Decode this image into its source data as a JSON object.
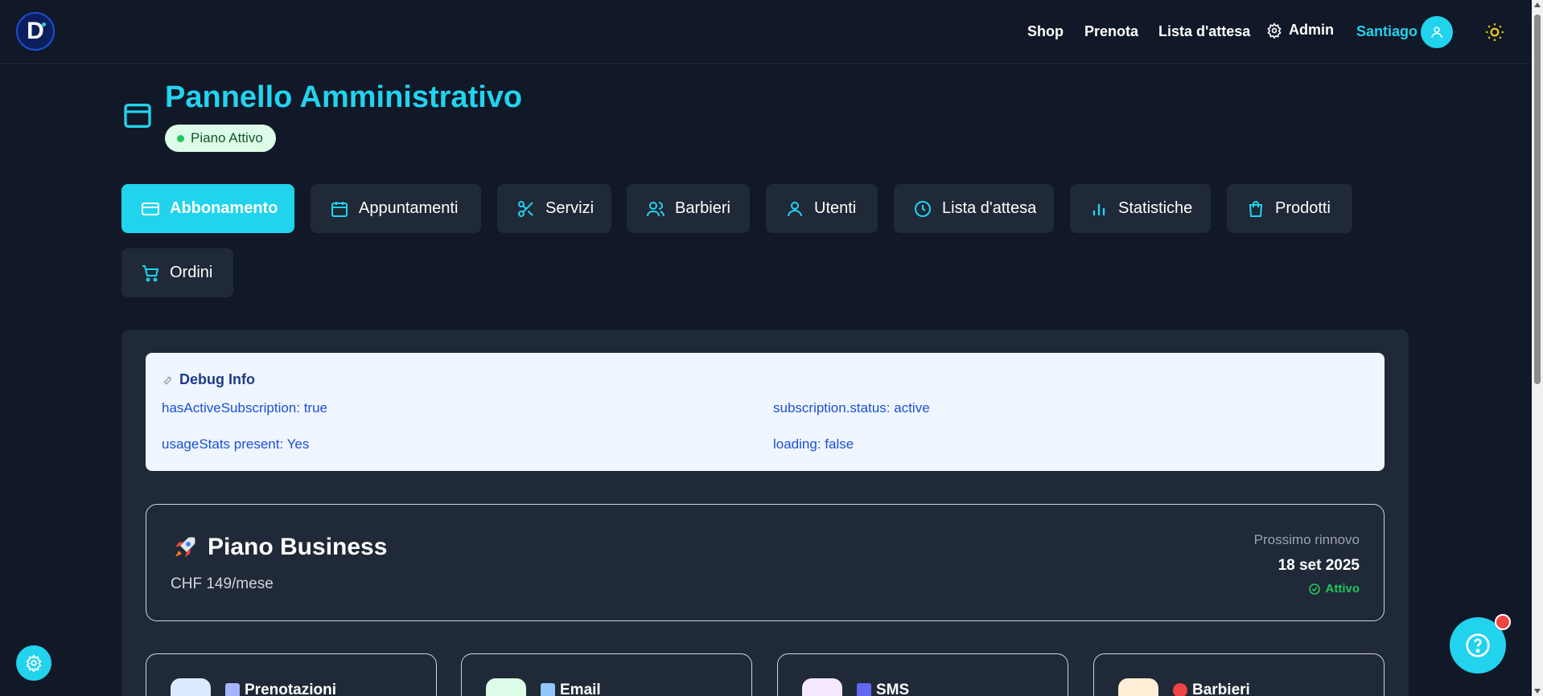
{
  "header": {
    "logo_letter": "D",
    "nav": [
      {
        "label": "Shop"
      },
      {
        "label": "Prenota"
      },
      {
        "label": "Lista d'attesa"
      },
      {
        "label": "Admin"
      }
    ],
    "user_name": "Santiago"
  },
  "page": {
    "title": "Pannello Amministrativo",
    "badge": "Piano Attivo"
  },
  "tabs": [
    {
      "label": "Abbonamento",
      "icon": "credit-card-icon",
      "active": true
    },
    {
      "label": "Appuntamenti",
      "icon": "calendar-icon"
    },
    {
      "label": "Servizi",
      "icon": "scissors-icon"
    },
    {
      "label": "Barbieri",
      "icon": "users-icon"
    },
    {
      "label": "Utenti",
      "icon": "user-icon"
    },
    {
      "label": "Lista d'attesa",
      "icon": "clock-icon"
    },
    {
      "label": "Statistiche",
      "icon": "bar-chart-icon"
    },
    {
      "label": "Prodotti",
      "icon": "shopping-bag-icon"
    },
    {
      "label": "Ordini",
      "icon": "shopping-cart-icon"
    }
  ],
  "debug": {
    "title": "Debug Info",
    "rows": [
      "hasActiveSubscription: true",
      "subscription.status: active",
      "usageStats present: Yes",
      "loading: false"
    ]
  },
  "plan": {
    "name": "Piano Business",
    "price": "CHF 149/mese",
    "renew_label": "Prossimo rinnovo",
    "renew_date": "18 set 2025",
    "status": "Attivo"
  },
  "usage": [
    {
      "label": "Prenotazioni",
      "color": "#dbeafe"
    },
    {
      "label": "Email",
      "color": "#dcfce7"
    },
    {
      "label": "SMS",
      "color": "#f3e8ff"
    },
    {
      "label": "Barbieri",
      "color": "#ffedd5"
    }
  ],
  "colors": {
    "accent": "#22d3ee",
    "background": "#111827",
    "surface": "#1f2937",
    "success": "#22c55e"
  }
}
